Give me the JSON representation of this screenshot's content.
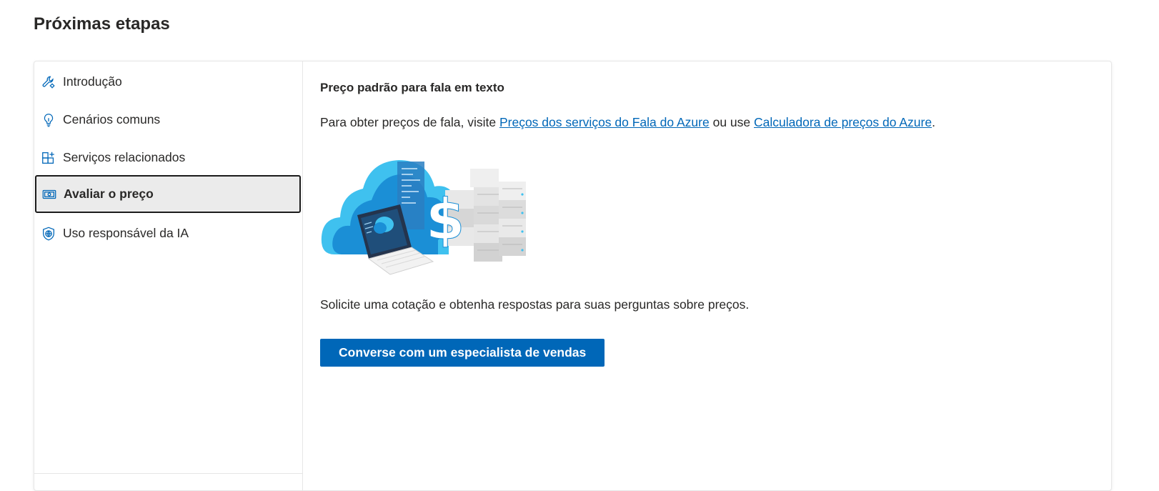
{
  "page": {
    "title": "Próximas etapas"
  },
  "sidebar": {
    "items": [
      {
        "label": "Introdução",
        "icon": "wrench-gear-icon",
        "active": false
      },
      {
        "label": "Cenários comuns",
        "icon": "lightbulb-icon",
        "active": false
      },
      {
        "label": "Serviços relacionados",
        "icon": "grid-add-icon",
        "active": false
      },
      {
        "label": "Avaliar o preço",
        "icon": "money-icon",
        "active": true
      },
      {
        "label": "Uso responsável da IA",
        "icon": "shield-globe-icon",
        "active": false
      }
    ]
  },
  "content": {
    "heading": "Preço padrão para fala em texto",
    "pricing_prefix": "Para obter preços de fala, visite ",
    "pricing_link1": "Preços dos serviços do Fala do Azure",
    "pricing_middle": " ou use ",
    "pricing_link2": "Calculadora de preços do Azure",
    "pricing_suffix": ".",
    "quote_text": "Solicite uma cotação e obtenha respostas para suas perguntas sobre preços.",
    "cta_label": "Converse com um especialista de vendas"
  },
  "colors": {
    "accent": "#0067b8",
    "text": "#292827",
    "active_bg": "#ebebeb",
    "border": "#e6e6e6"
  }
}
